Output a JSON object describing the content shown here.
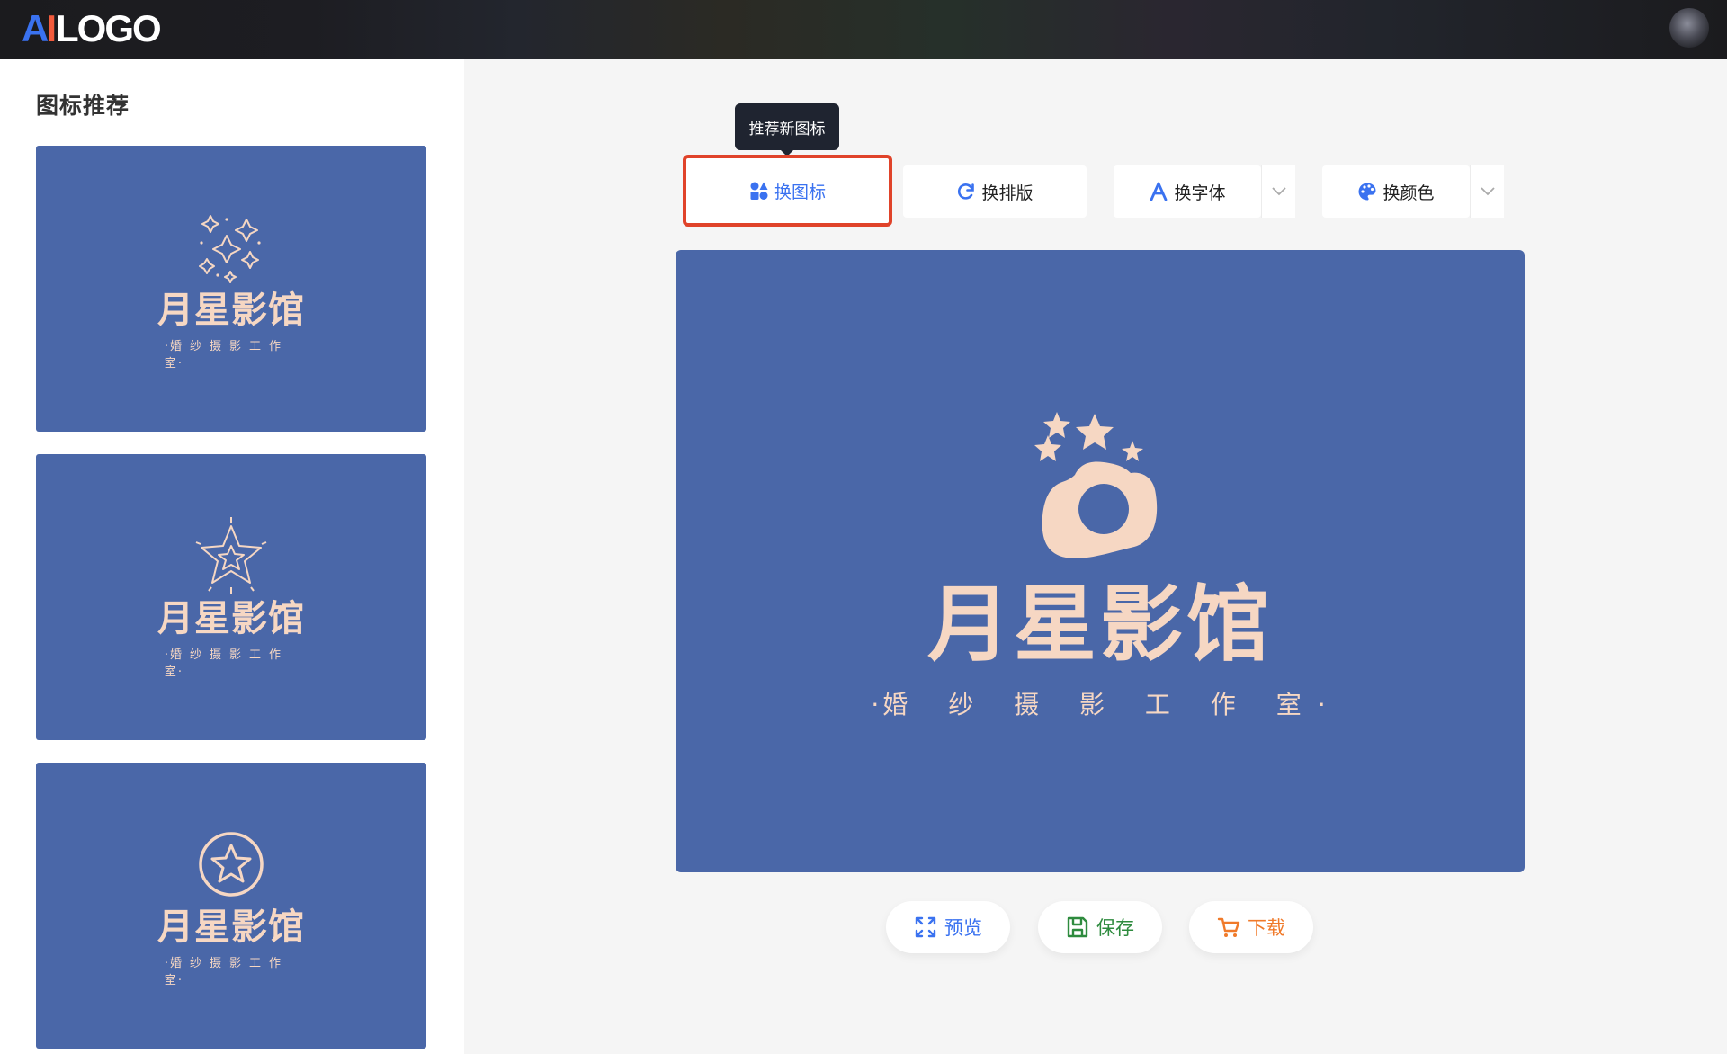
{
  "header": {
    "logo": {
      "part_a": "A",
      "part_i": "I",
      "part_rest": "LOGO"
    },
    "avatar_icon": "user-avatar"
  },
  "sidebar": {
    "title": "图标推荐",
    "cards": [
      {
        "icon": "sparkles-icon",
        "name": "月星影馆",
        "subtitle": "婚纱摄影工作室"
      },
      {
        "icon": "star-burst-icon",
        "name": "月星影馆",
        "subtitle": "婚纱摄影工作室"
      },
      {
        "icon": "star-circle-icon",
        "name": "月星影馆",
        "subtitle": "婚纱摄影工作室"
      }
    ]
  },
  "toolbar": {
    "tooltip": "推荐新图标",
    "change_icon": "换图标",
    "change_layout": "换排版",
    "change_font": "换字体",
    "change_color": "换颜色"
  },
  "preview": {
    "name": "月星影馆",
    "subtitle": "婚 纱 摄 影 工 作 室",
    "background_color": "#4a67a8",
    "logo_color": "#f6d7c3",
    "icon": "camera-stars-icon"
  },
  "actions": {
    "preview": "预览",
    "save": "保存",
    "download": "下载"
  },
  "colors": {
    "accent": "#3a72f0",
    "highlight_border": "#e0432a",
    "save_green": "#2e8b3e",
    "download_orange": "#f07a2a"
  }
}
